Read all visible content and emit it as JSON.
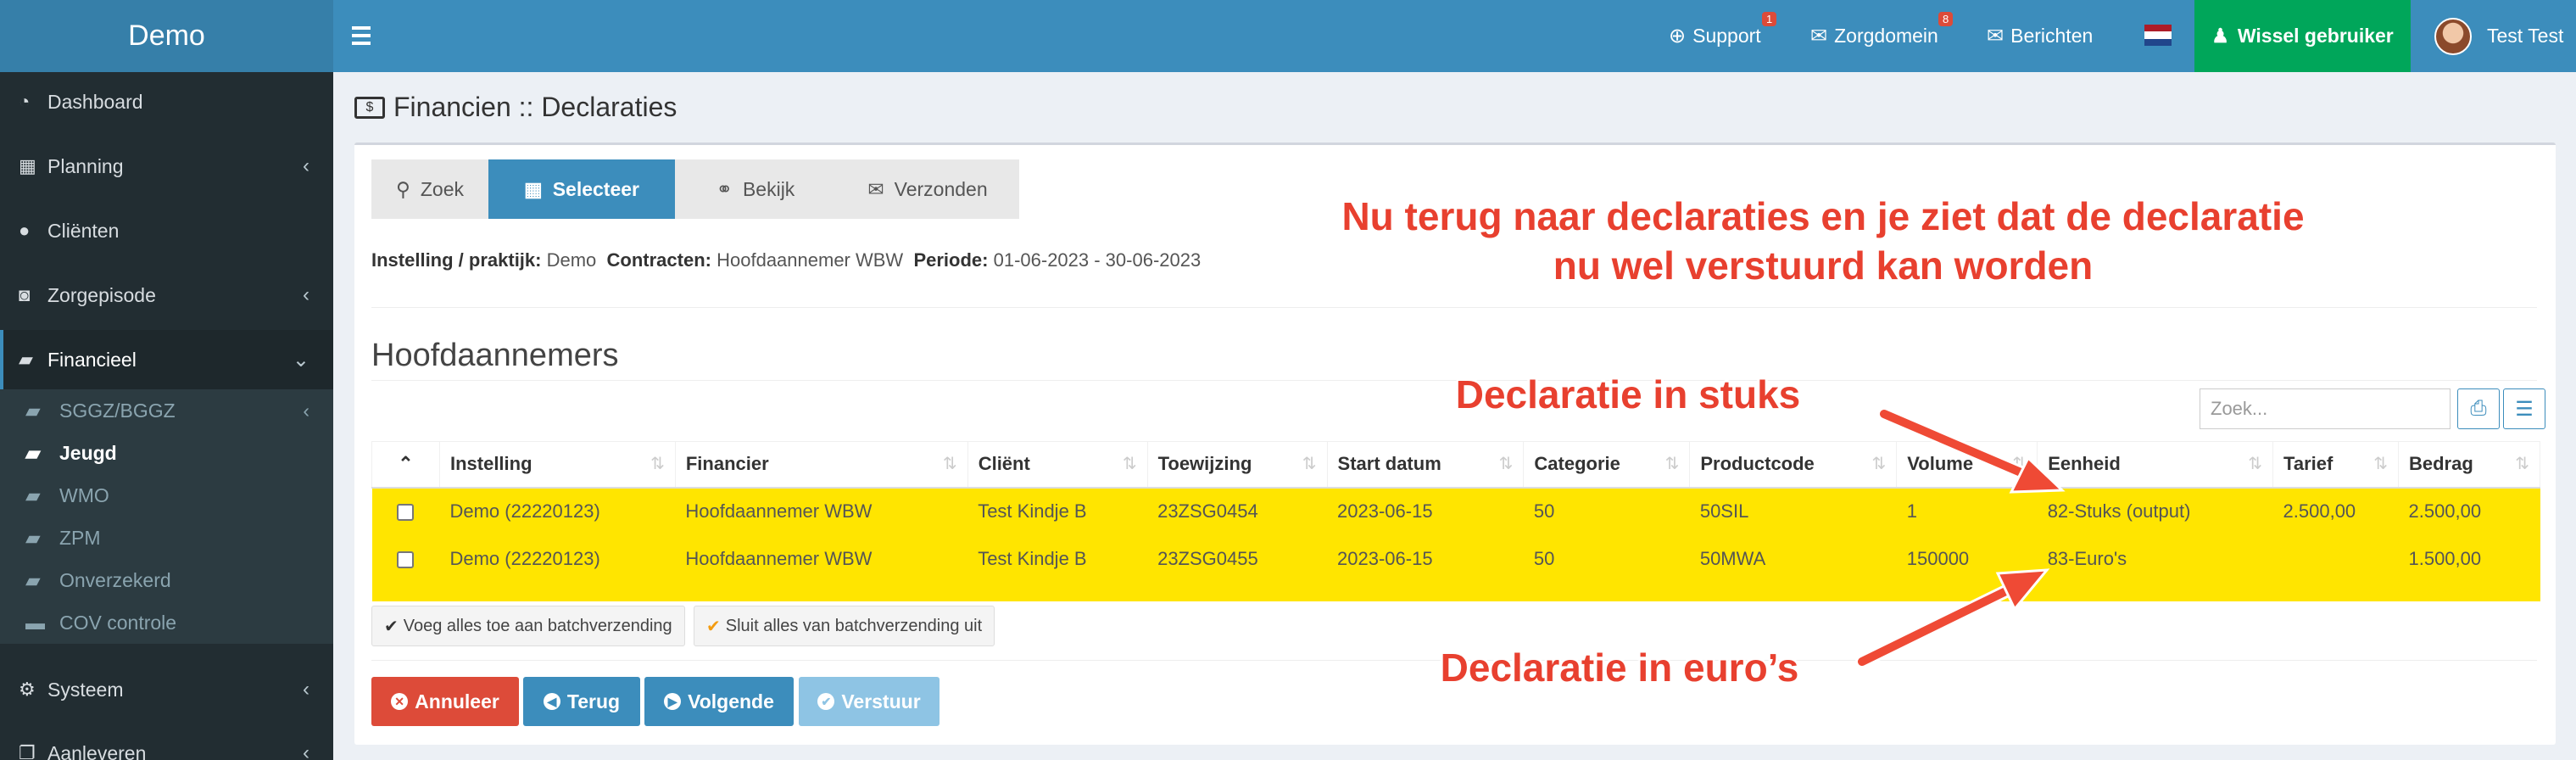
{
  "app": {
    "title": "Demo"
  },
  "topbar": {
    "support": {
      "label": "Support",
      "badge": "1"
    },
    "zorgdomein": {
      "label": "Zorgdomein",
      "badge": "8"
    },
    "berichten": {
      "label": "Berichten"
    },
    "wissel": {
      "label": "Wissel gebruiker"
    },
    "user": {
      "name": "Test Test"
    }
  },
  "sidebar": {
    "items": [
      {
        "label": "Dashboard",
        "icon": "dashboard-icon"
      },
      {
        "label": "Planning",
        "icon": "calendar-icon"
      },
      {
        "label": "Cliënten",
        "icon": "user-icon"
      },
      {
        "label": "Zorgepisode",
        "icon": "camera-icon"
      },
      {
        "label": "Financieel",
        "icon": "book-icon"
      },
      {
        "label": "Systeem",
        "icon": "gears-icon"
      },
      {
        "label": "Aanleveren",
        "icon": "copy-icon"
      }
    ],
    "subitems": [
      {
        "label": "SGGZ/BGGZ"
      },
      {
        "label": "Jeugd"
      },
      {
        "label": "WMO"
      },
      {
        "label": "ZPM"
      },
      {
        "label": "Onverzekerd"
      },
      {
        "label": "COV controle"
      }
    ]
  },
  "page": {
    "title": "Financien :: Declaraties"
  },
  "wizard": {
    "steps": [
      {
        "label": "Zoek"
      },
      {
        "label": "Selecteer"
      },
      {
        "label": "Bekijk"
      },
      {
        "label": "Verzonden"
      }
    ]
  },
  "filters": {
    "instelling_label": "Instelling / praktijk:",
    "instelling_value": "Demo",
    "contracten_label": "Contracten:",
    "contracten_value": "Hoofdaannemer WBW",
    "periode_label": "Periode:",
    "periode_value": "01-06-2023 - 30-06-2023"
  },
  "section": {
    "title": "Hoofdaannemers"
  },
  "search": {
    "placeholder": "Zoek..."
  },
  "table": {
    "columns": [
      "Instelling",
      "Financier",
      "Cliënt",
      "Toewijzing",
      "Start datum",
      "Categorie",
      "Productcode",
      "Volume",
      "Eenheid",
      "Tarief",
      "Bedrag"
    ],
    "rows": [
      [
        "Demo (22220123)",
        "Hoofdaannemer WBW",
        "Test Kindje B",
        "23ZSG0454",
        "2023-06-15",
        "50",
        "50SIL",
        "1",
        "82-Stuks (output)",
        "2.500,00",
        "2.500,00"
      ],
      [
        "Demo (22220123)",
        "Hoofdaannemer WBW",
        "Test Kindje B",
        "23ZSG0455",
        "2023-06-15",
        "50",
        "50MWA",
        "150000",
        "83-Euro's",
        "",
        "1.500,00"
      ]
    ]
  },
  "batch": {
    "add_all": "Voeg alles toe aan batchverzending",
    "exclude_all": "Sluit alles van batchverzending uit"
  },
  "actions": {
    "annuleer": "Annuleer",
    "terug": "Terug",
    "volgende": "Volgende",
    "verstuur": "Verstuur"
  },
  "annotations": {
    "main_line1": "Nu terug naar declaraties en je ziet dat de declaratie",
    "main_line2": "nu wel verstuurd kan worden",
    "stuks": "Declaratie in stuks",
    "euros": "Declaratie in euro’s"
  },
  "colors": {
    "header": "#3c8dbc",
    "logo": "#367fa9",
    "sidebar": "#222d32",
    "wissel": "#00a65a",
    "highlight": "#ffe500",
    "danger": "#dd4b39",
    "annotation": "#e8402f"
  }
}
